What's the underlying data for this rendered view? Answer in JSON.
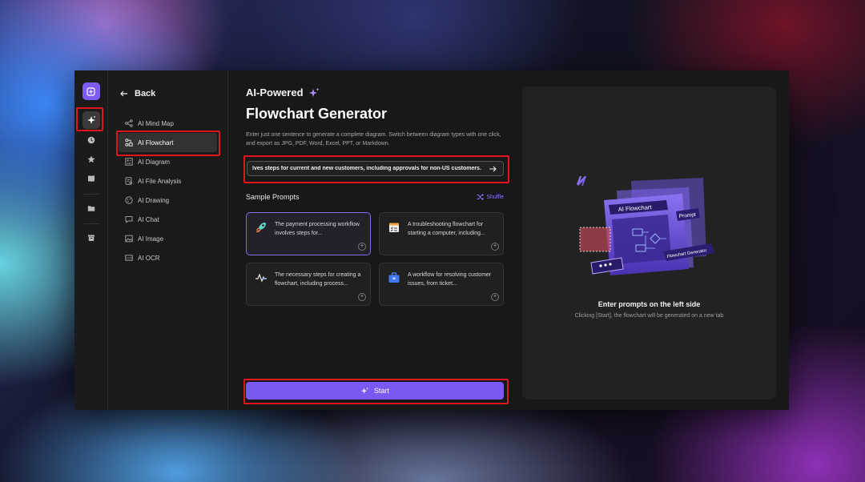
{
  "rail": {
    "new_icon": "plus-square-icon",
    "ai_icon": "sparkle-icon",
    "recent_icon": "clock-icon",
    "star_icon": "star-icon",
    "book_icon": "book-icon",
    "folder_icon": "folder-icon",
    "trash_icon": "trash-icon"
  },
  "sidenav": {
    "back_label": "Back",
    "items": [
      {
        "label": "AI Mind Map",
        "icon": "mind-map-icon"
      },
      {
        "label": "AI Flowchart",
        "icon": "flowchart-icon"
      },
      {
        "label": "AI Diagram",
        "icon": "diagram-icon"
      },
      {
        "label": "AI File Analysis",
        "icon": "file-analysis-icon"
      },
      {
        "label": "AI Drawing",
        "icon": "drawing-icon"
      },
      {
        "label": "AI Chat",
        "icon": "chat-icon"
      },
      {
        "label": "AI Image",
        "icon": "image-icon"
      },
      {
        "label": "AI OCR",
        "icon": "ocr-icon"
      }
    ],
    "active": "AI Flowchart"
  },
  "main": {
    "small_title": "AI-Powered",
    "title": "Flowchart Generator",
    "description": "Enter just one sentence to generate a complete diagram. Switch between diagram types with one click, and export as JPG, PDF, Word, Excel, PPT, or Markdown.",
    "prompt_value": "lves steps for current and new customers, including approvals for non-US customers.",
    "samples_title": "Sample Prompts",
    "shuffle_label": "Shuffle",
    "cards": [
      {
        "text": "The payment processing workflow involves steps for...",
        "icon": "rocket-icon"
      },
      {
        "text": "A troubleshooting flowchart for starting a computer, including...",
        "icon": "checklist-icon"
      },
      {
        "text": "The necessary steps for creating a flowchart, including process...",
        "icon": "pulse-icon"
      },
      {
        "text": "A workflow for resolving customer issues, from ticket...",
        "icon": "briefcase-icon"
      }
    ],
    "start_label": "Start"
  },
  "preview": {
    "title": "Enter prompts on the left side",
    "subtitle": "Clicking [Start], the flowchart will be generated on a new tab",
    "illus_labels": {
      "window": "AI Flowchart",
      "tag1": "Prompt",
      "tag2": "Flowchart Generator"
    }
  },
  "colors": {
    "accent": "#7a59f2",
    "highlight": "#e0161e"
  }
}
